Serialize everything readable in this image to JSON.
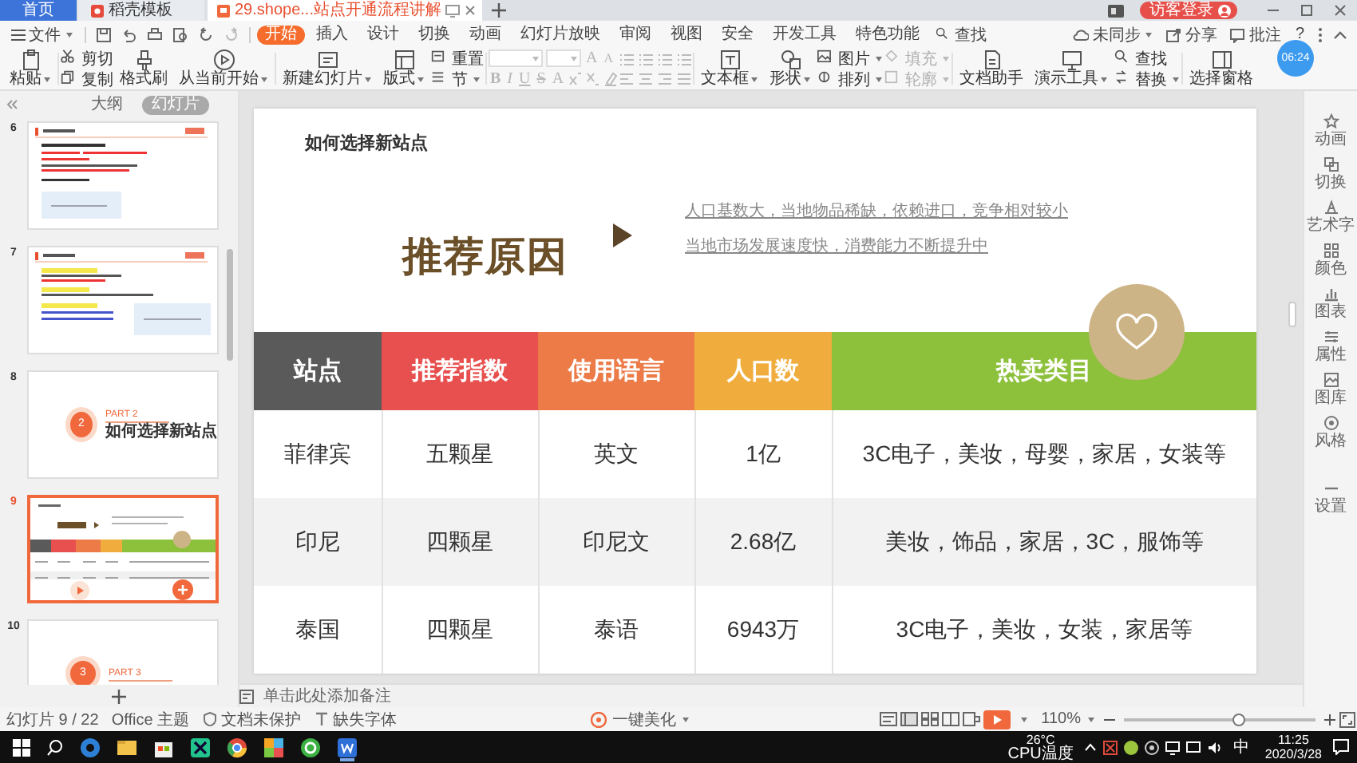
{
  "title_bar": {
    "tabs": [
      {
        "label": "首页",
        "kind": "home",
        "selected": false
      },
      {
        "label": "稻壳模板",
        "kind": "template",
        "selected": false
      },
      {
        "label": "29.shope...站点开通流程讲解",
        "kind": "document",
        "selected": true
      }
    ],
    "account": "访客登录"
  },
  "menu_bar": {
    "file": "文件",
    "tabs": [
      {
        "label": "开始",
        "selected": true
      },
      {
        "label": "插入",
        "selected": false
      },
      {
        "label": "设计",
        "selected": false
      },
      {
        "label": "切换",
        "selected": false
      },
      {
        "label": "动画",
        "selected": false
      },
      {
        "label": "幻灯片放映",
        "selected": false
      },
      {
        "label": "审阅",
        "selected": false
      },
      {
        "label": "视图",
        "selected": false
      },
      {
        "label": "安全",
        "selected": false
      },
      {
        "label": "开发工具",
        "selected": false
      },
      {
        "label": "特色功能",
        "selected": false
      }
    ],
    "search": "查找",
    "actions": [
      "未同步",
      "分享",
      "批注"
    ],
    "help": "?"
  },
  "ribbon": [
    {
      "kind": "large",
      "label": "粘贴",
      "dropdown": true,
      "disabled": false
    },
    {
      "kind": "stack",
      "items": [
        {
          "label": "剪切",
          "dropdown": false,
          "disabled": false
        },
        {
          "label": "复制",
          "dropdown": false,
          "disabled": false
        }
      ]
    },
    {
      "kind": "large",
      "label": "格式刷",
      "dropdown": false,
      "disabled": false
    },
    {
      "kind": "large",
      "label": "从当前开始",
      "dropdown": true,
      "disabled": false
    },
    {
      "kind": "large",
      "label": "新建幻灯片",
      "dropdown": true,
      "disabled": false
    },
    {
      "kind": "large",
      "label": "版式",
      "dropdown": true,
      "disabled": false
    },
    {
      "kind": "stack",
      "items": [
        {
          "label": "重置",
          "dropdown": false,
          "disabled": false
        },
        {
          "label": "节",
          "dropdown": true,
          "disabled": false
        }
      ]
    },
    {
      "kind": "font",
      "size_buttons": [
        "A",
        "A"
      ],
      "style_buttons": [
        "B",
        "I",
        "U",
        "S",
        "A"
      ],
      "disabled": true
    },
    {
      "kind": "paragraph",
      "disabled": true
    },
    {
      "kind": "large",
      "label": "文本框",
      "dropdown": true,
      "disabled": false
    },
    {
      "kind": "large",
      "label": "形状",
      "dropdown": true,
      "disabled": false
    },
    {
      "kind": "stack",
      "items": [
        {
          "label": "图片",
          "dropdown": true,
          "disabled": false
        },
        {
          "label": "排列",
          "dropdown": true,
          "disabled": false
        }
      ]
    },
    {
      "kind": "stack",
      "items": [
        {
          "label": "填充",
          "dropdown": true,
          "disabled": true
        },
        {
          "label": "轮廓",
          "dropdown": true,
          "disabled": true
        }
      ]
    },
    {
      "kind": "large",
      "label": "文档助手",
      "dropdown": false,
      "disabled": false
    },
    {
      "kind": "large",
      "label": "演示工具",
      "dropdown": true,
      "disabled": false
    },
    {
      "kind": "stack",
      "items": [
        {
          "label": "查找",
          "dropdown": false,
          "disabled": false
        },
        {
          "label": "替换",
          "dropdown": true,
          "disabled": false
        }
      ]
    },
    {
      "kind": "large",
      "label": "选择窗格",
      "dropdown": false,
      "disabled": false
    }
  ],
  "timer": "06:24",
  "slide_panel": {
    "tabs": [
      {
        "label": "大纲",
        "selected": false
      },
      {
        "label": "幻灯片",
        "selected": true
      }
    ],
    "slides": [
      {
        "number": "6",
        "kind": "content",
        "selected": false
      },
      {
        "number": "7",
        "kind": "content",
        "selected": false
      },
      {
        "number": "8",
        "kind": "section",
        "badge": "2",
        "part": "PART 2",
        "title": "如何选择新站点",
        "selected": false
      },
      {
        "number": "9",
        "kind": "table",
        "selected": true
      },
      {
        "number": "10",
        "kind": "section",
        "badge": "3",
        "part": "PART 3",
        "selected": false
      }
    ]
  },
  "slide": {
    "heading": "如何选择新站点",
    "feature_title": "推荐原因",
    "reasons": [
      "人口基数大，当地物品稀缺，依赖进口，竞争相对较小",
      "当地市场发展速度快，消费能力不断提升中"
    ],
    "table": {
      "columns": [
        {
          "label": "站点",
          "color": "#5a5a5a"
        },
        {
          "label": "推荐指数",
          "color": "#e8504f"
        },
        {
          "label": "使用语言",
          "color": "#ec7b48"
        },
        {
          "label": "人口数",
          "color": "#f0ad3d"
        },
        {
          "label": "热卖类目",
          "color": "#8dc13c"
        }
      ],
      "rows": [
        [
          "菲律宾",
          "五颗星",
          "英文",
          "1亿",
          "3C电子，美妆，母婴，家居，女装等"
        ],
        [
          "印尼",
          "四颗星",
          "印尼文",
          "2.68亿",
          "美妆，饰品，家居，3C，服饰等"
        ],
        [
          "泰国",
          "四颗星",
          "泰语",
          "6943万",
          "3C电子，美妆，女装，家居等"
        ]
      ]
    }
  },
  "notes": {
    "placeholder": "单击此处添加备注"
  },
  "side_bar": [
    "动画",
    "切换",
    "艺术字",
    "颜色",
    "图表",
    "属性",
    "图库",
    "风格",
    "设置"
  ],
  "status_bar": {
    "slide_count": "幻灯片 9 / 22",
    "theme": "Office 主题",
    "protection": "文档未保护",
    "fonts": "缺失字体",
    "beautify": "一键美化",
    "zoom": {
      "label": "110%",
      "level": 0.6
    }
  },
  "taskbar": {
    "temperature": "26°C",
    "sensor": "CPU温度",
    "ime": "中",
    "time": "11:25",
    "date": "2020/3/28"
  }
}
